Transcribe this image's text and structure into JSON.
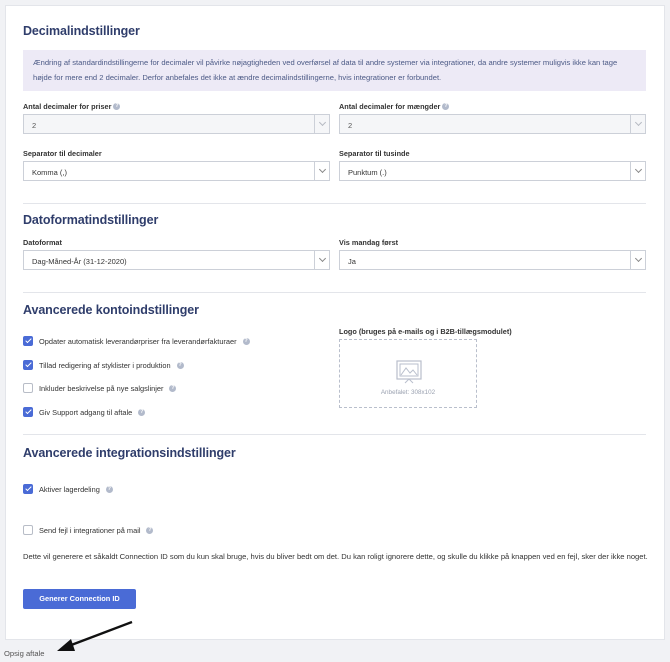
{
  "decimals": {
    "title": "Decimalindstillinger",
    "notice": "Ændring af standardindstillingerne for decimaler vil påvirke nøjagtigheden ved overførsel af data til andre systemer via integrationer, da andre systemer muligvis ikke kan tage højde for mere end 2 decimaler. Derfor anbefales det ikke at ændre decimalindstillingerne, hvis integrationer er forbundet.",
    "price_decimals_label": "Antal decimaler for priser",
    "price_decimals_value": "2",
    "qty_decimals_label": "Antal decimaler for mængder",
    "qty_decimals_value": "2",
    "decimal_sep_label": "Separator til decimaler",
    "decimal_sep_value": "Komma (,)",
    "thousand_sep_label": "Separator til tusinde",
    "thousand_sep_value": "Punktum (.)"
  },
  "dateformat": {
    "title": "Datoformatindstillinger",
    "format_label": "Datoformat",
    "format_value": "Dag-Måned-År (31-12-2020)",
    "monday_label": "Vis mandag først",
    "monday_value": "Ja"
  },
  "account": {
    "title": "Avancerede kontoindstillinger",
    "checkboxes": [
      {
        "label": "Opdater automatisk leverandørpriser fra leverandørfakturaer",
        "checked": true
      },
      {
        "label": "Tillad redigering af styklister i produktion",
        "checked": true
      },
      {
        "label": "Inkluder beskrivelse på nye salgslinjer",
        "checked": false
      },
      {
        "label": "Giv Support adgang til aftale",
        "checked": true
      }
    ],
    "logo_label": "Logo (bruges på e-mails og i B2B-tillægsmodulet)",
    "logo_hint": "Anbefalet: 308x102"
  },
  "integration": {
    "title": "Avancerede integrationsindstillinger",
    "checkboxes": [
      {
        "label": "Aktiver lagerdeling",
        "checked": true
      },
      {
        "label": "Send fejl i integrationer på mail",
        "checked": false
      }
    ],
    "info": "Dette vil generere et såkaldt Connection ID som du kun skal bruge, hvis du bliver bedt om det. Du kan roligt ignorere dette, og skulle du klikke på knappen ved en fejl, sker der ikke noget.",
    "button": "Generer Connection ID"
  },
  "footer": {
    "cancel_link": "Opsig aftale"
  },
  "colors": {
    "accent": "#4a6bd6",
    "heading": "#2f3d6b",
    "notice_bg": "#edeaf6"
  }
}
